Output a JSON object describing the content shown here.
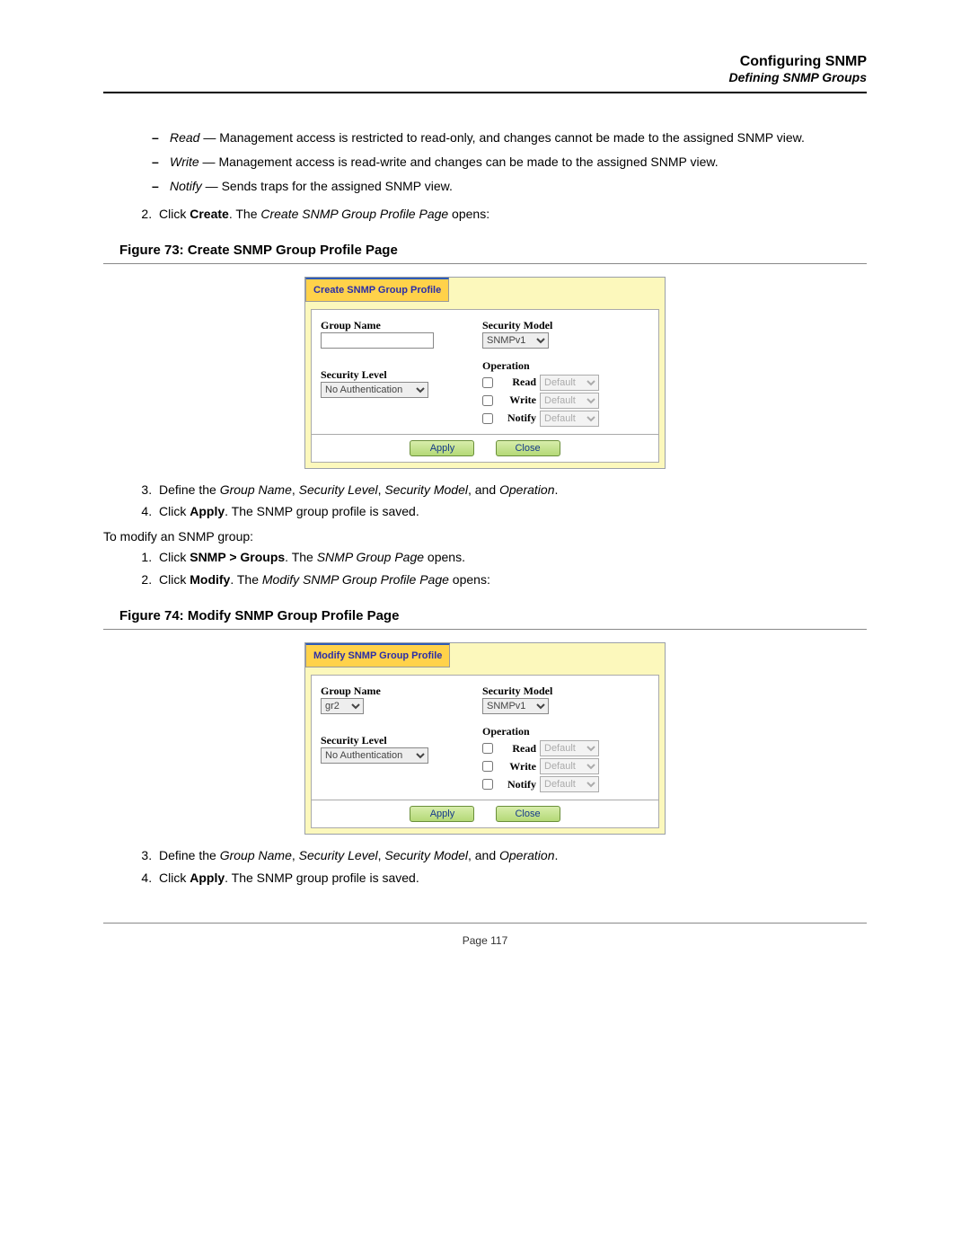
{
  "header": {
    "title": "Configuring SNMP",
    "subtitle": "Defining SNMP Groups"
  },
  "bullets": {
    "read_label": "Read",
    "read_text": " — Management access is restricted to read-only, and changes cannot be made to the assigned SNMP view.",
    "write_label": "Write",
    "write_text": " — Management access is read-write and changes can be made to the assigned SNMP view.",
    "notify_label": "Notify",
    "notify_text": " — Sends traps for the assigned SNMP view."
  },
  "step2a_pre": "Click ",
  "step2a_bold": "Create",
  "step2a_mid": ". The ",
  "step2a_ital": "Create SNMP Group Profile Page",
  "step2a_post": " opens:",
  "fig73_caption": "Figure 73:  Create SNMP Group Profile Page",
  "fig73": {
    "tab": "Create SNMP Group Profile",
    "group_name_label": "Group Name",
    "group_name_value": "",
    "security_model_label": "Security Model",
    "security_model_value": "SNMPv1",
    "security_level_label": "Security Level",
    "security_level_value": "No Authentication",
    "operation_label": "Operation",
    "op_read": "Read",
    "op_write": "Write",
    "op_notify": "Notify",
    "op_default": "Default",
    "apply": "Apply",
    "close": "Close"
  },
  "mid_steps": {
    "s3_pre": "Define the ",
    "s3_i1": "Group Name",
    "s3_c1": ", ",
    "s3_i2": "Security Level",
    "s3_c2": ", ",
    "s3_i3": "Security Model",
    "s3_c3": ", and ",
    "s3_i4": "Operation",
    "s3_post": ".",
    "s4_pre": "Click ",
    "s4_b": "Apply",
    "s4_post": ". The SNMP group profile is saved."
  },
  "to_modify": "To modify an SNMP group:",
  "mod_steps": {
    "s1_pre": "Click ",
    "s1_b": "SNMP > Groups",
    "s1_mid": ". The ",
    "s1_i": "SNMP Group Page",
    "s1_post": " opens.",
    "s2_pre": "Click ",
    "s2_b": "Modify",
    "s2_mid": ". The ",
    "s2_i": "Modify SNMP Group Profile Page",
    "s2_post": " opens:"
  },
  "fig74_caption": "Figure 74:  Modify SNMP Group Profile Page",
  "fig74": {
    "tab": "Modify SNMP Group Profile",
    "group_name_label": "Group Name",
    "group_name_value": "gr2",
    "security_model_label": "Security Model",
    "security_model_value": "SNMPv1",
    "security_level_label": "Security Level",
    "security_level_value": "No Authentication",
    "operation_label": "Operation",
    "op_read": "Read",
    "op_write": "Write",
    "op_notify": "Notify",
    "op_default": "Default",
    "apply": "Apply",
    "close": "Close"
  },
  "footer": "Page 117"
}
